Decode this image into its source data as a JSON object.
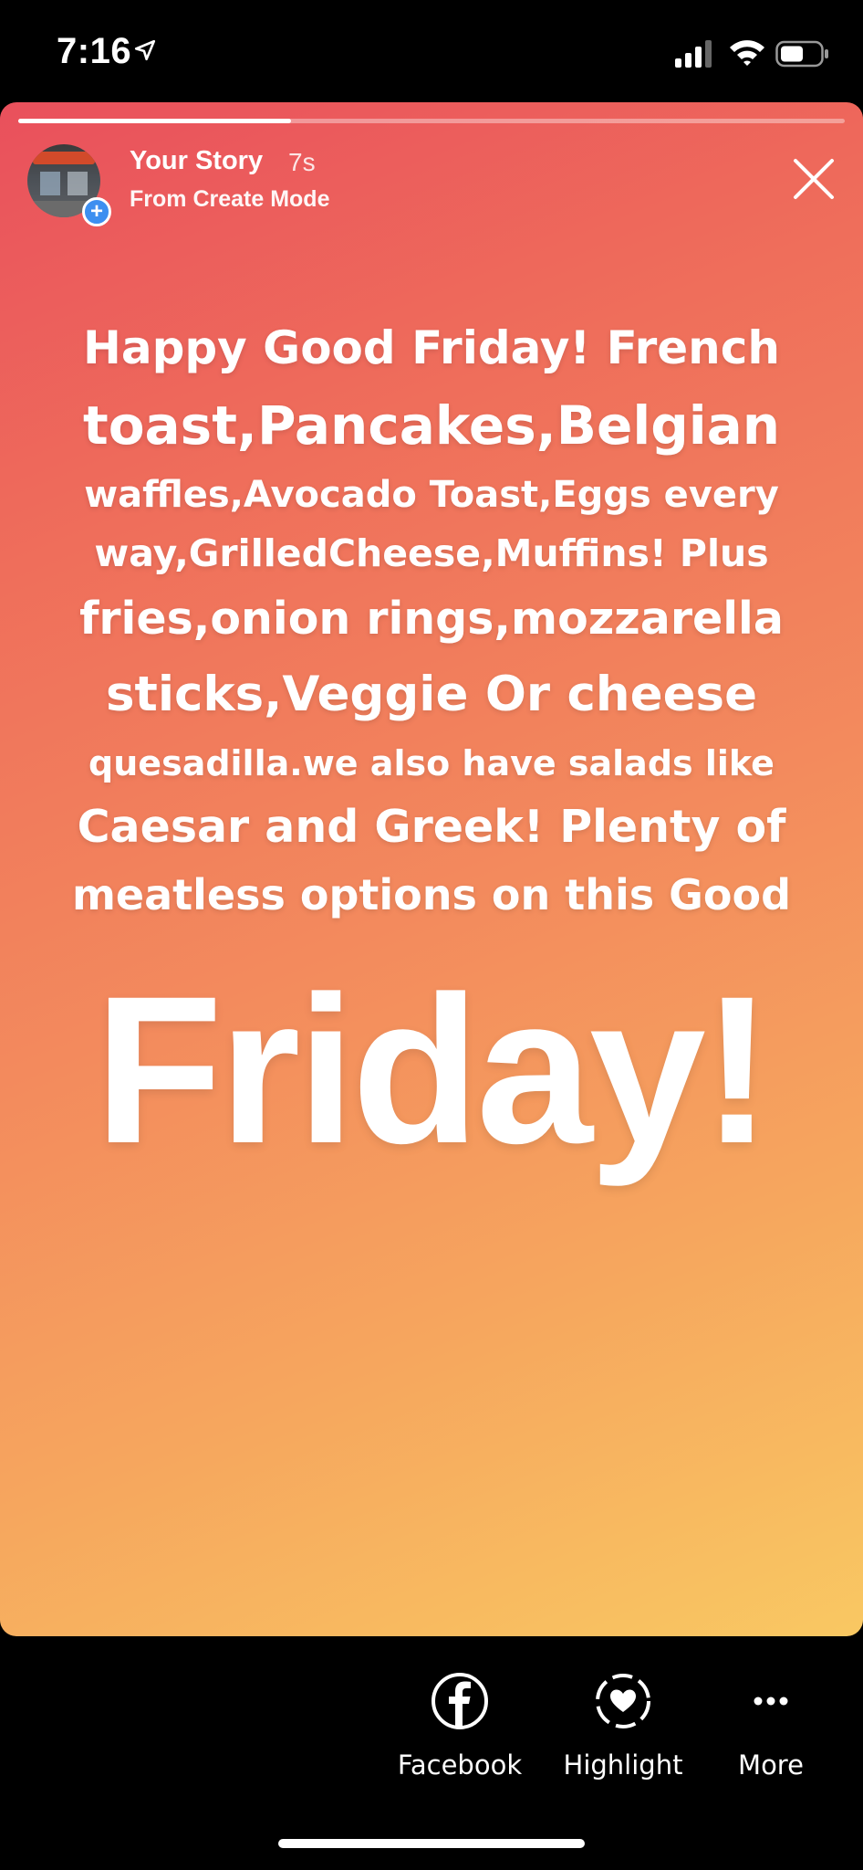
{
  "status_bar": {
    "time": "7:16"
  },
  "story": {
    "progress_fraction": 0.33,
    "title": "Your Story",
    "age": "7s",
    "subtitle": "From Create Mode",
    "gradient_colors": [
      "#e9505c",
      "#f38a5d",
      "#f9c862"
    ],
    "text_lines": [
      "Happy Good Friday! French",
      "toast,Pancakes,Belgian",
      "waffles,Avocado Toast,Eggs every",
      "way,GrilledCheese,Muffins! Plus",
      "fries,onion rings,mozzarella",
      "sticks,Veggie Or cheese",
      "quesadilla.we also have salads like",
      "Caesar and Greek! Plenty of",
      "meatless options on this Good"
    ],
    "big_word": "Friday!"
  },
  "actions": {
    "facebook_label": "Facebook",
    "highlight_label": "Highlight",
    "more_label": "More"
  },
  "icons": [
    "location-arrow-icon",
    "signal-icon",
    "wifi-icon",
    "battery-icon",
    "close-icon",
    "facebook-icon",
    "highlight-heart-icon",
    "more-dots-icon"
  ],
  "accent_color": "#3d8ff0"
}
